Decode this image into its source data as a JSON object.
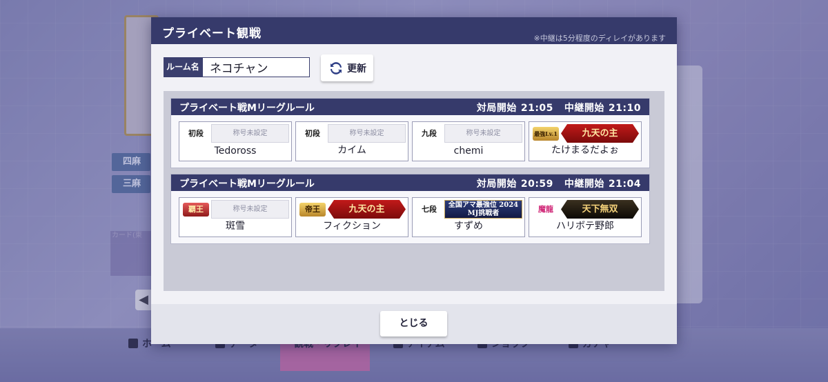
{
  "background": {
    "tags": [
      "四麻",
      "三麻"
    ],
    "card_label": "カード(東",
    "nav": [
      "ホーム",
      "データ",
      "観戦・リプレイ",
      "アイテム",
      "ショップ",
      "ガチャ"
    ]
  },
  "modal": {
    "title": "プライベート観戦",
    "note": "※中継は5分程度のディレイがあります",
    "room": {
      "label": "ルーム名",
      "value": "ネコチャン"
    },
    "refresh_label": "更新",
    "close_label": "とじる"
  },
  "matches": [
    {
      "rule": "プライベート戦Mリーグルール",
      "start_label": "対局開始",
      "start_time": "21:05",
      "relay_label": "中継開始",
      "relay_time": "21:10",
      "players": [
        {
          "rank": "初段",
          "title": "称号未設定",
          "name": "Tedoross"
        },
        {
          "rank": "初段",
          "title": "称号未設定",
          "name": "カイム"
        },
        {
          "rank": "九段",
          "title": "称号未設定",
          "name": "chemi"
        },
        {
          "rank": "最強Lv.1",
          "title": "九天の主",
          "name": "たけまるだよぉ"
        }
      ]
    },
    {
      "rule": "プライベート戦Mリーグルール",
      "start_label": "対局開始",
      "start_time": "20:59",
      "relay_label": "中継開始",
      "relay_time": "21:04",
      "players": [
        {
          "rank": "覇王",
          "title": "称号未設定",
          "name": "斑雪"
        },
        {
          "rank": "帝王",
          "title": "九天の主",
          "name": "フィクション"
        },
        {
          "rank": "七段",
          "title": "全国アマ最強位 2024 MJ挑戦者",
          "name": "すずめ"
        },
        {
          "rank": "魔龍",
          "title": "天下無双",
          "name": "ハリボテ野郎"
        }
      ]
    }
  ]
}
